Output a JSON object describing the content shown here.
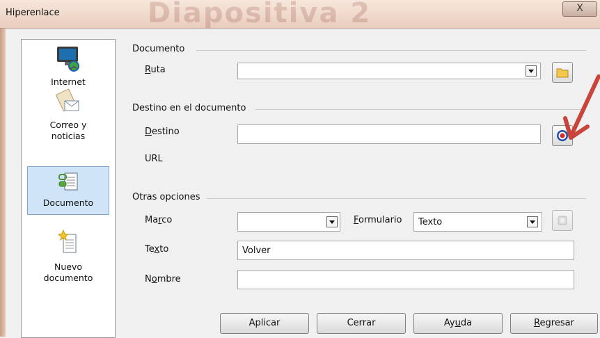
{
  "window": {
    "title": "Hiperenlace",
    "background_title": "Diapositiva 2",
    "close_label": "X"
  },
  "sidebar": {
    "items": [
      {
        "label": "Internet",
        "icon": "internet-globe-icon"
      },
      {
        "label": "Correo y noticias",
        "icon": "mail-letter-icon"
      },
      {
        "label": "Documento",
        "icon": "document-link-icon",
        "selected": true
      },
      {
        "label": "Nuevo documento",
        "icon": "new-document-icon"
      }
    ]
  },
  "document": {
    "section_title": "Documento",
    "path": {
      "label_pre": "",
      "label_u": "R",
      "label_post": "uta",
      "value": ""
    }
  },
  "target": {
    "section_title": "Destino en el documento",
    "destination": {
      "label_u": "D",
      "label_post": "estino",
      "value": ""
    },
    "url": {
      "label": "URL",
      "value": ""
    }
  },
  "options": {
    "section_title": "Otras opciones",
    "frame": {
      "label_pre": "Ma",
      "label_u": "r",
      "label_post": "co",
      "value": ""
    },
    "form": {
      "label_u": "F",
      "label_post": "ormulario",
      "value": "Texto"
    },
    "text": {
      "label_pre": "Te",
      "label_u": "x",
      "label_post": "to",
      "value": "Volver"
    },
    "name": {
      "label_pre": "N",
      "label_u": "o",
      "label_post": "mbre",
      "value": ""
    }
  },
  "buttons": {
    "apply": "Aplicar",
    "close": "Cerrar",
    "help_pre": "Ay",
    "help_u": "u",
    "help_post": "da",
    "back_u": "R",
    "back_post": "egresar"
  },
  "colors": {
    "arrow": "#c9443a",
    "selection": "#cfe4f7"
  }
}
